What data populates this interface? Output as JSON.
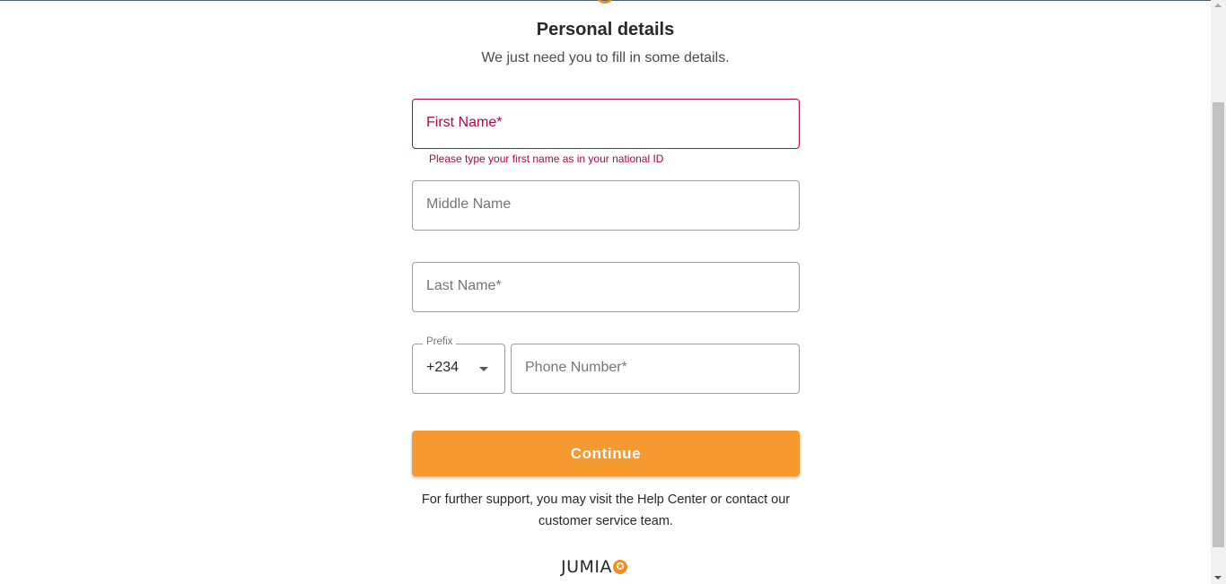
{
  "header": {
    "title": "Personal details",
    "subtitle": "We just need you to fill in some details."
  },
  "form": {
    "first_name": {
      "placeholder": "First Name*",
      "value": "",
      "error": "Please type your first name as in your national ID"
    },
    "middle_name": {
      "placeholder": "Middle Name",
      "value": ""
    },
    "last_name": {
      "placeholder": "Last Name*",
      "value": ""
    },
    "prefix": {
      "label": "Prefix",
      "value": "+234"
    },
    "phone_number": {
      "placeholder": "Phone Number*",
      "value": ""
    },
    "continue_label": "Continue"
  },
  "support": {
    "text": "For further support, you may visit the Help Center or contact our customer service team."
  },
  "brand": {
    "name": "JUMIA",
    "star_glyph": "✪",
    "accent_color": "#f68b1e"
  },
  "icons": [
    "chevron-down-icon",
    "star-icon"
  ]
}
